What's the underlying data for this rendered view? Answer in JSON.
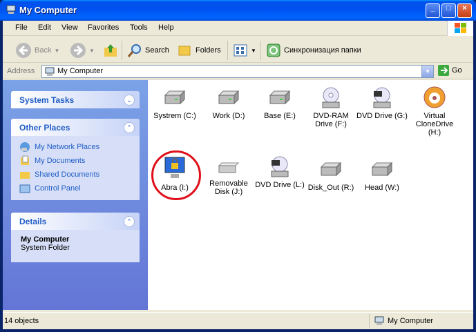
{
  "window": {
    "title": "My Computer"
  },
  "menu": [
    "File",
    "Edit",
    "View",
    "Favorites",
    "Tools",
    "Help"
  ],
  "toolbar": {
    "back": "Back",
    "search": "Search",
    "folders": "Folders",
    "sync": "Синхронизация папки"
  },
  "address": {
    "label": "Address",
    "value": "My Computer",
    "go": "Go"
  },
  "tasks": {
    "system_tasks": "System Tasks",
    "other_places": {
      "title": "Other Places",
      "items": [
        "My Network Places",
        "My Documents",
        "Shared Documents",
        "Control Panel"
      ]
    },
    "details": {
      "title": "Details",
      "name": "My Computer",
      "type": "System Folder"
    }
  },
  "drives": [
    {
      "label": "Systrem (C:)",
      "icon": "hard-drive-icon"
    },
    {
      "label": "Work (D:)",
      "icon": "hard-drive-icon"
    },
    {
      "label": "Base (E:)",
      "icon": "hard-drive-icon"
    },
    {
      "label": "DVD-RAM Drive (F:)",
      "icon": "dvd-drive-icon"
    },
    {
      "label": "DVD Drive (G:)",
      "icon": "dvd-drive-icon"
    },
    {
      "label": "Virtual CloneDrive (H:)",
      "icon": "clonedrive-icon"
    },
    {
      "label": "Abra (I:)",
      "icon": "locked-monitor-icon"
    },
    {
      "label": "Removable Disk (J:)",
      "icon": "removable-disk-icon"
    },
    {
      "label": "DVD Drive (L:)",
      "icon": "dvd-drive-icon"
    },
    {
      "label": "Disk_Out (R:)",
      "icon": "hard-drive-icon"
    },
    {
      "label": "Head (W:)",
      "icon": "hard-drive-icon"
    }
  ],
  "status": {
    "count": "14 objects",
    "location": "My Computer"
  },
  "colors": {
    "highlight_circle": "#e0101a",
    "link": "#215dc6"
  }
}
